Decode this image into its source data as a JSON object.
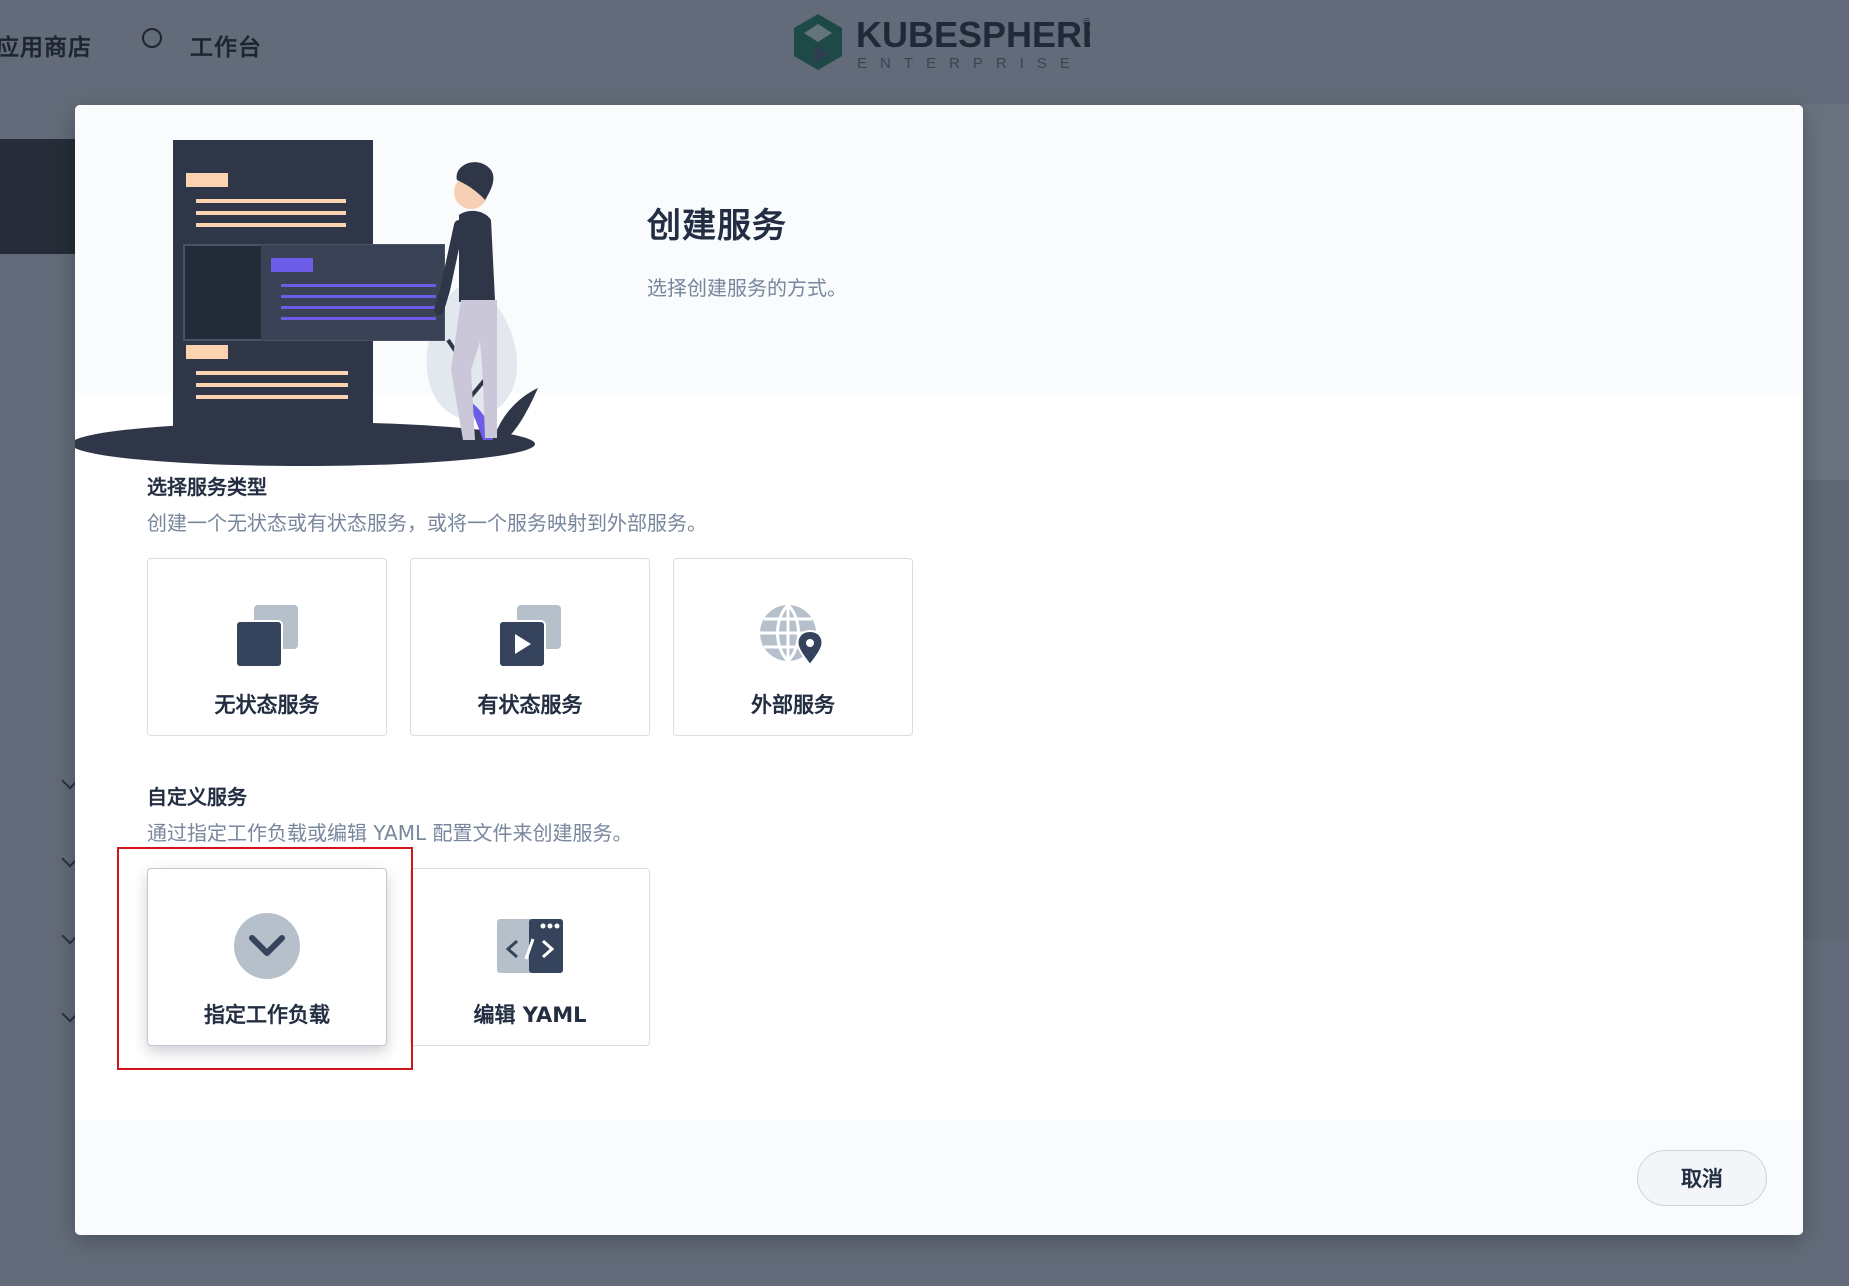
{
  "topbar": {
    "nav_app_store": "应用商店",
    "nav_workbench": "工作台",
    "logo_main": "KUBESPHERE",
    "logo_sub": "ENTERPRISE",
    "logo_mark": "®"
  },
  "modal": {
    "title": "创建服务",
    "description": "选择创建服务的方式。",
    "service_types": {
      "title": "选择服务类型",
      "description": "创建一个无状态或有状态服务，或将一个服务映射到外部服务。",
      "cards": [
        {
          "label": "无状态服务",
          "icon": "stateless-service-icon"
        },
        {
          "label": "有状态服务",
          "icon": "stateful-service-icon"
        },
        {
          "label": "外部服务",
          "icon": "external-service-icon"
        }
      ]
    },
    "custom": {
      "title": "自定义服务",
      "description": "通过指定工作负载或编辑 YAML 配置文件来创建服务。",
      "cards": [
        {
          "label": "指定工作负载",
          "icon": "chevron-down-circle-icon",
          "highlighted": true
        },
        {
          "label": "编辑 YAML",
          "icon": "code-editor-icon"
        }
      ]
    },
    "cancel_label": "取消"
  },
  "colors": {
    "overlay": "#636b7a",
    "title": "#242e42",
    "muted_text": "#79879c",
    "highlight_border": "#d0161b",
    "accent_purple": "#6c5ce7"
  }
}
